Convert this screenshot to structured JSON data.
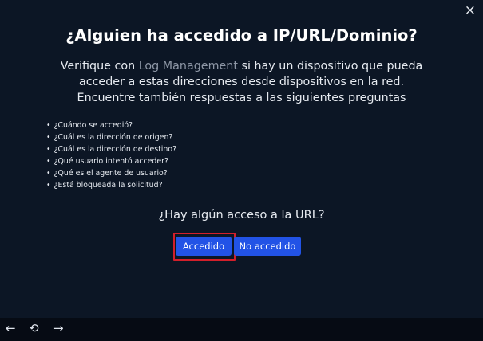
{
  "dialog": {
    "title": "¿Alguien ha accedido a IP/URL/Dominio?",
    "intro": {
      "prefix": "Verifique con ",
      "link": "Log Management",
      "line1_suffix": " si hay un dispositivo que pueda",
      "line2": "acceder a estas direcciones desde dispositivos en la red.",
      "line3": "Encuentre también respuestas a las siguientes preguntas"
    },
    "questions": [
      "¿Cuándo se accedió?",
      "¿Cuál es la dirección de origen?",
      "¿Cuál es la dirección de destino?",
      "¿Qué usuario intentó acceder?",
      "¿Qué es el agente de usuario?",
      "¿Está bloqueada la solicitud?"
    ],
    "prompt": "¿Hay algún acceso a la URL?",
    "buttons": {
      "accessed": "Accedido",
      "not_accessed": "No accedido"
    },
    "close_icon": "×"
  },
  "bottom_nav": {
    "back_icon": "←",
    "reload_icon": "⟲",
    "forward_icon": "→"
  },
  "colors": {
    "background": "#0c1625",
    "button": "#2253e6",
    "highlight": "#d31f2a",
    "link": "#8e97a6",
    "bottom_bar": "#060b14"
  }
}
